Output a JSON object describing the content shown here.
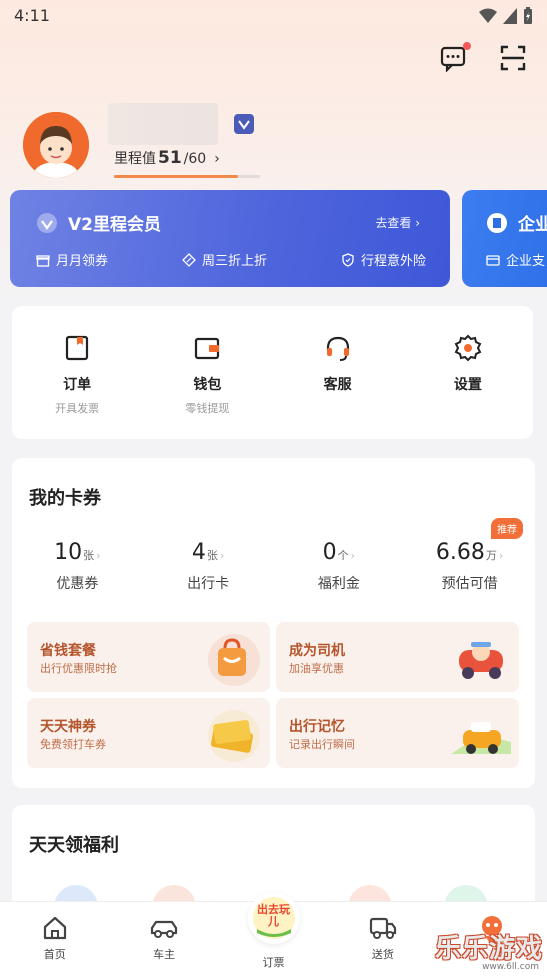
{
  "status_bar": {
    "time": "4:11"
  },
  "profile": {
    "mileage_label": "里程值",
    "mileage_value": "51",
    "mileage_total": "/60",
    "mileage_progress": 0.85
  },
  "member_card": {
    "title": "V2里程会员",
    "goto": "去查看",
    "perks": [
      "月月领券",
      "周三折上折",
      "行程意外险"
    ]
  },
  "enterprise_card": {
    "title": "企业",
    "sub": "企业支"
  },
  "quick_menu": [
    {
      "label": "订单",
      "sub": "开具发票",
      "icon": "order-icon"
    },
    {
      "label": "钱包",
      "sub": "零钱提现",
      "icon": "wallet-icon"
    },
    {
      "label": "客服",
      "sub": "",
      "icon": "headset-icon"
    },
    {
      "label": "设置",
      "sub": "",
      "icon": "gear-icon"
    }
  ],
  "my_cards": {
    "title": "我的卡券",
    "stats": [
      {
        "value": "10",
        "unit": "张",
        "label": "优惠券"
      },
      {
        "value": "4",
        "unit": "张",
        "label": "出行卡"
      },
      {
        "value": "0",
        "unit": "个",
        "label": "福利金"
      },
      {
        "value": "6.68",
        "unit": "万",
        "label": "预估可借",
        "tag": "推荐"
      }
    ],
    "promos": [
      {
        "title": "省钱套餐",
        "sub": "出行优惠限时抢"
      },
      {
        "title": "成为司机",
        "sub": "加油享优惠"
      },
      {
        "title": "天天神券",
        "sub": "免费领打车券"
      },
      {
        "title": "出行记忆",
        "sub": "记录出行瞬间"
      }
    ]
  },
  "welfare": {
    "title": "天天领福利"
  },
  "tabbar": [
    {
      "label": "首页",
      "icon": "home-icon"
    },
    {
      "label": "车主",
      "icon": "car-icon"
    },
    {
      "label": "订票",
      "icon": "ticket-icon",
      "badge": "出去玩儿"
    },
    {
      "label": "送货",
      "icon": "truck-icon"
    },
    {
      "label": "",
      "icon": "mascot-icon"
    }
  ],
  "watermark": {
    "text": "乐乐游戏",
    "url": "www.6ll.com"
  },
  "colors": {
    "accent": "#f26f3a",
    "member_blue": "#4d64dc",
    "enterprise_blue": "#2e6fe8"
  }
}
